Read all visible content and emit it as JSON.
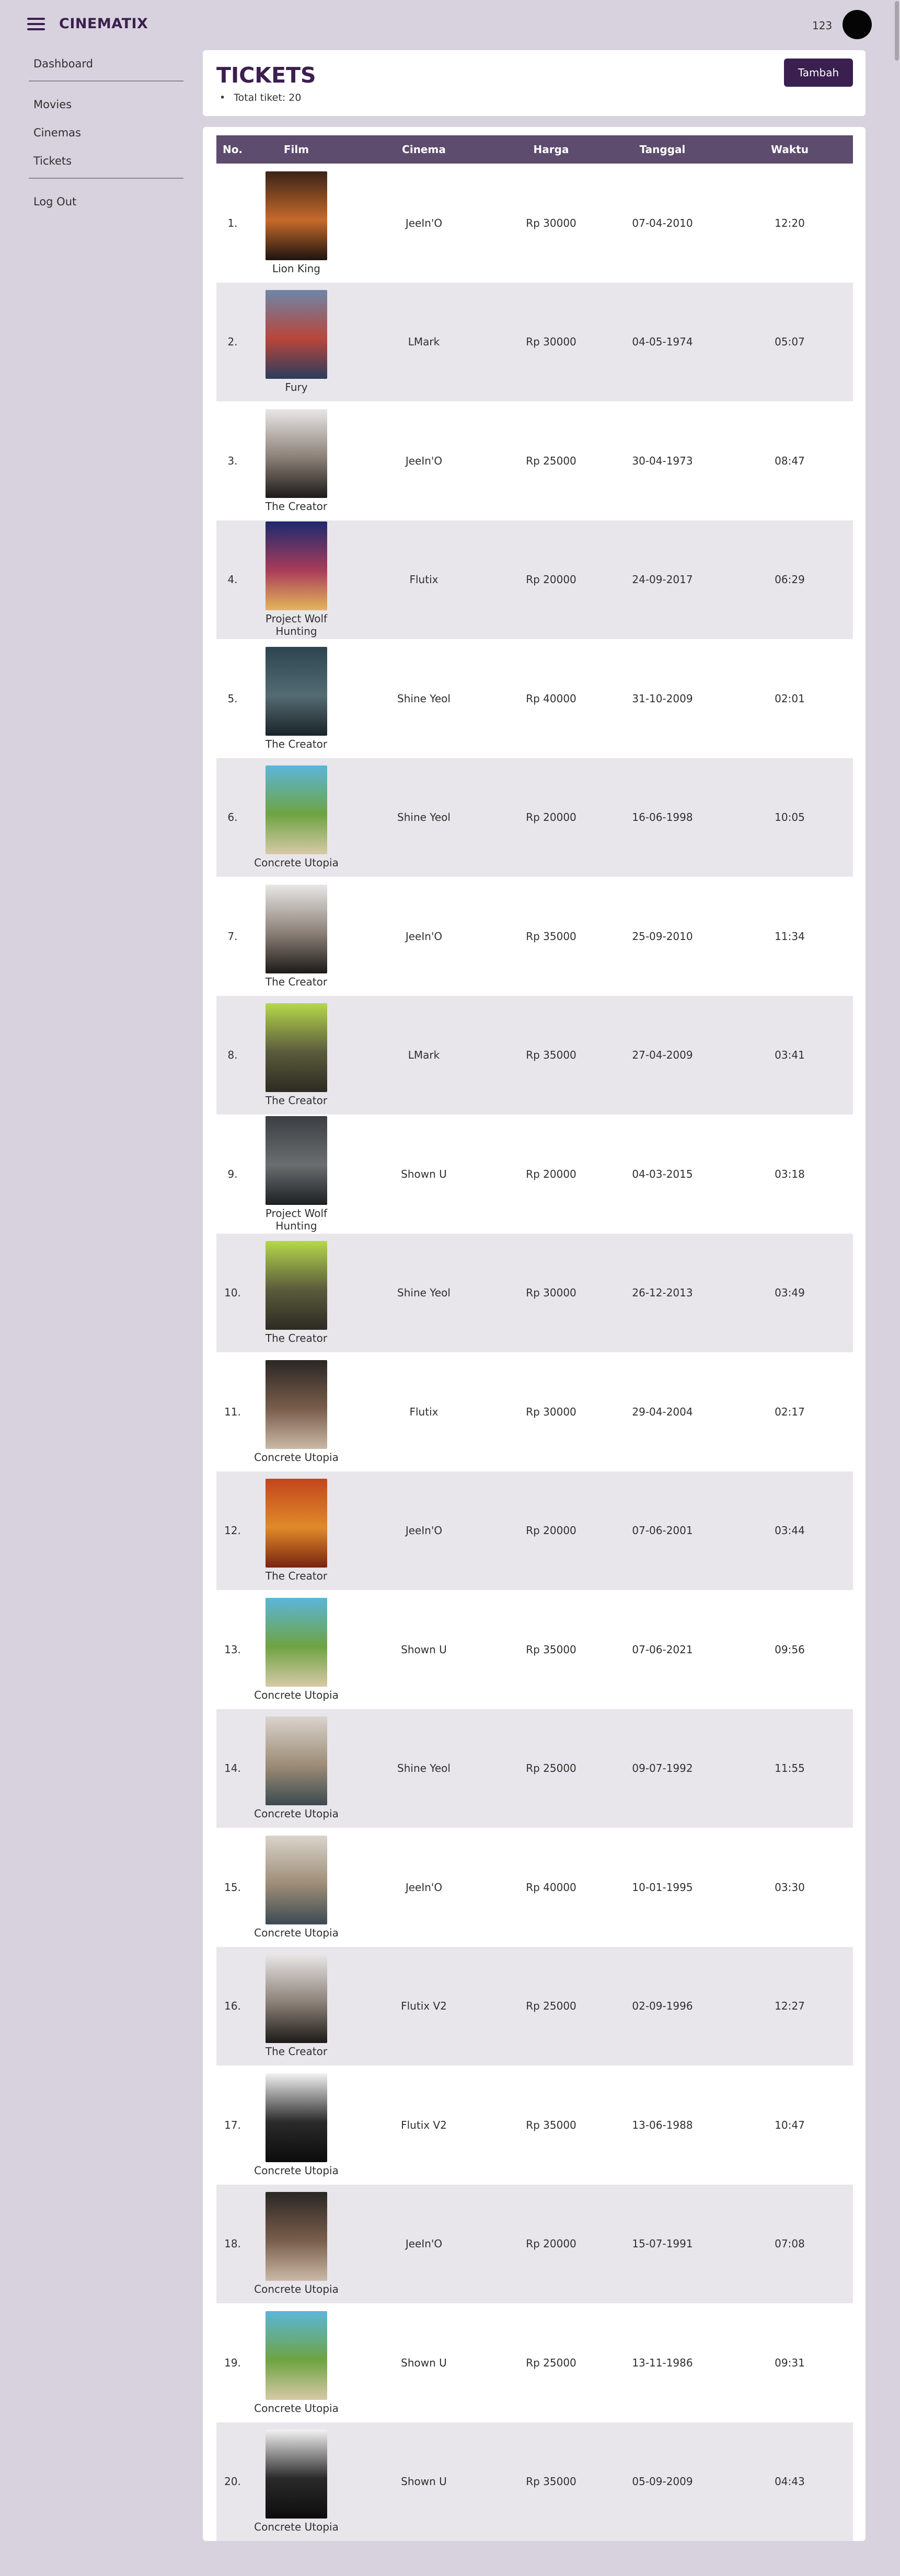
{
  "app": {
    "brand": "CINEMATIX",
    "username": "123"
  },
  "sidebar": {
    "items": [
      {
        "label": "Dashboard"
      },
      {
        "label": "Movies"
      },
      {
        "label": "Cinemas"
      },
      {
        "label": "Tickets"
      },
      {
        "label": "Log Out"
      }
    ]
  },
  "header": {
    "title": "TICKETS",
    "total": "Total tiket: 20",
    "add_label": "Tambah"
  },
  "table": {
    "columns": [
      "No.",
      "Film",
      "Cinema",
      "Harga",
      "Tanggal",
      "Waktu"
    ],
    "rows": [
      {
        "no": "1.",
        "film": "Lion King",
        "cinema": "JeeIn'O",
        "harga": "Rp 30000",
        "tanggal": "07-04-2010",
        "waktu": "12:20",
        "poster": [
          "#3a2418",
          "#c76a2a",
          "#1c1410"
        ]
      },
      {
        "no": "2.",
        "film": "Fury",
        "cinema": "LMark",
        "harga": "Rp 30000",
        "tanggal": "04-05-1974",
        "waktu": "05:07",
        "poster": [
          "#6d86a8",
          "#b8463a",
          "#2b3c5c"
        ]
      },
      {
        "no": "3.",
        "film": "The Creator",
        "cinema": "JeeIn'O",
        "harga": "Rp 25000",
        "tanggal": "30-04-1973",
        "waktu": "08:47",
        "poster": [
          "#e9e7e6",
          "#8a7f76",
          "#1d1a19"
        ]
      },
      {
        "no": "4.",
        "film": "Project Wolf Hunting",
        "cinema": "Flutix",
        "harga": "Rp 20000",
        "tanggal": "24-09-2017",
        "waktu": "06:29",
        "poster": [
          "#1d2a6e",
          "#a83c5a",
          "#e3b65a"
        ]
      },
      {
        "no": "5.",
        "film": "The Creator",
        "cinema": "Shine Yeol",
        "harga": "Rp 40000",
        "tanggal": "31-10-2009",
        "waktu": "02:01",
        "poster": [
          "#2b4550",
          "#546b72",
          "#1a2428"
        ]
      },
      {
        "no": "6.",
        "film": "Concrete Utopia",
        "cinema": "Shine Yeol",
        "harga": "Rp 20000",
        "tanggal": "16-06-1998",
        "waktu": "10:05",
        "poster": [
          "#5bb6d9",
          "#6ea342",
          "#d7c9a6"
        ]
      },
      {
        "no": "7.",
        "film": "The Creator",
        "cinema": "JeeIn'O",
        "harga": "Rp 35000",
        "tanggal": "25-09-2010",
        "waktu": "11:34",
        "poster": [
          "#e9e7e6",
          "#8a7f76",
          "#1d1a19"
        ]
      },
      {
        "no": "8.",
        "film": "The Creator",
        "cinema": "LMark",
        "harga": "Rp 35000",
        "tanggal": "27-04-2009",
        "waktu": "03:41",
        "poster": [
          "#b6d84a",
          "#5a5b3c",
          "#2d2a22"
        ]
      },
      {
        "no": "9.",
        "film": "Project Wolf Hunting",
        "cinema": "Shown U",
        "harga": "Rp 20000",
        "tanggal": "04-03-2015",
        "waktu": "03:18",
        "poster": [
          "#3b3f44",
          "#6a6e6f",
          "#1e2022"
        ]
      },
      {
        "no": "10.",
        "film": "The Creator",
        "cinema": "Shine Yeol",
        "harga": "Rp 30000",
        "tanggal": "26-12-2013",
        "waktu": "03:49",
        "poster": [
          "#b6d84a",
          "#5a5b3c",
          "#2d2a22"
        ]
      },
      {
        "no": "11.",
        "film": "Concrete Utopia",
        "cinema": "Flutix",
        "harga": "Rp 30000",
        "tanggal": "29-04-2004",
        "waktu": "02:17",
        "poster": [
          "#2a2724",
          "#7a5e4c",
          "#c9b9a6"
        ]
      },
      {
        "no": "12.",
        "film": "The Creator",
        "cinema": "JeeIn'O",
        "harga": "Rp 20000",
        "tanggal": "07-06-2001",
        "waktu": "03:44",
        "poster": [
          "#c4451c",
          "#e08a2a",
          "#7a2410"
        ]
      },
      {
        "no": "13.",
        "film": "Concrete Utopia",
        "cinema": "Shown U",
        "harga": "Rp 35000",
        "tanggal": "07-06-2021",
        "waktu": "09:56",
        "poster": [
          "#5bb6d9",
          "#6ea342",
          "#d7c9a6"
        ]
      },
      {
        "no": "14.",
        "film": "Concrete Utopia",
        "cinema": "Shine Yeol",
        "harga": "Rp 25000",
        "tanggal": "09-07-1992",
        "waktu": "11:55",
        "poster": [
          "#d9d4cc",
          "#9d8c76",
          "#3c4a52"
        ]
      },
      {
        "no": "15.",
        "film": "Concrete Utopia",
        "cinema": "JeeIn'O",
        "harga": "Rp 40000",
        "tanggal": "10-01-1995",
        "waktu": "03:30",
        "poster": [
          "#d9d4cc",
          "#9d8c76",
          "#3c4a52"
        ]
      },
      {
        "no": "16.",
        "film": "The Creator",
        "cinema": "Flutix V2",
        "harga": "Rp 25000",
        "tanggal": "02-09-1996",
        "waktu": "12:27",
        "poster": [
          "#e9e7e6",
          "#8a7f76",
          "#1d1a19"
        ]
      },
      {
        "no": "17.",
        "film": "Concrete Utopia",
        "cinema": "Flutix V2",
        "harga": "Rp 35000",
        "tanggal": "13-06-1988",
        "waktu": "10:47",
        "poster": [
          "#f2f2f2",
          "#2a2a2a",
          "#0c0c0c"
        ]
      },
      {
        "no": "18.",
        "film": "Concrete Utopia",
        "cinema": "JeeIn'O",
        "harga": "Rp 20000",
        "tanggal": "15-07-1991",
        "waktu": "07:08",
        "poster": [
          "#2a2724",
          "#7a5e4c",
          "#c9b9a6"
        ]
      },
      {
        "no": "19.",
        "film": "Concrete Utopia",
        "cinema": "Shown U",
        "harga": "Rp 25000",
        "tanggal": "13-11-1986",
        "waktu": "09:31",
        "poster": [
          "#5bb6d9",
          "#6ea342",
          "#d7c9a6"
        ]
      },
      {
        "no": "20.",
        "film": "Concrete Utopia",
        "cinema": "Shown U",
        "harga": "Rp 35000",
        "tanggal": "05-09-2009",
        "waktu": "04:43",
        "poster": [
          "#f2f2f2",
          "#2a2a2a",
          "#0c0c0c"
        ]
      }
    ]
  },
  "colors": {
    "accent": "#3a1f4f",
    "header_row": "#5d4c6d",
    "background": "#d8d2de",
    "row_alt": "#e8e6ea"
  }
}
